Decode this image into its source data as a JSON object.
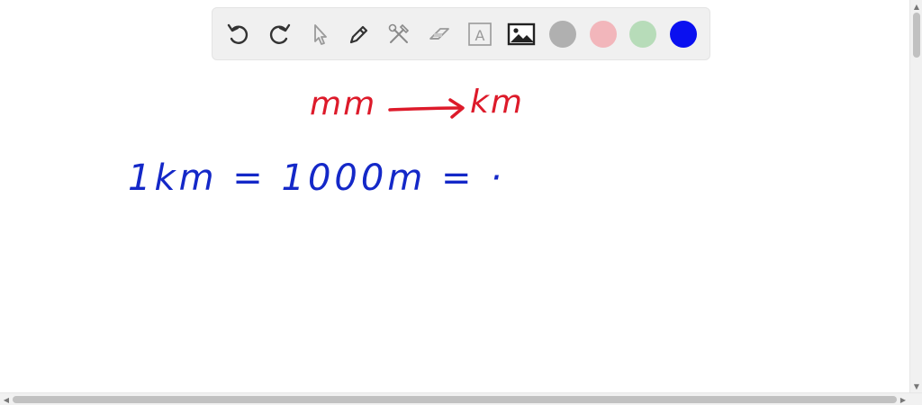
{
  "toolbar": {
    "tools": [
      {
        "name": "undo-icon"
      },
      {
        "name": "redo-icon"
      },
      {
        "name": "select-arrow-icon"
      },
      {
        "name": "pen-icon"
      },
      {
        "name": "tools-icon"
      },
      {
        "name": "eraser-icon"
      },
      {
        "name": "text-box-icon",
        "glyph": "A"
      },
      {
        "name": "image-icon"
      }
    ],
    "colors": [
      {
        "name": "gray",
        "hex": "#b0b0b0"
      },
      {
        "name": "pink",
        "hex": "#f2b6bb"
      },
      {
        "name": "light-green",
        "hex": "#b7dcb9"
      },
      {
        "name": "blue",
        "hex": "#0a10f0",
        "selected": true
      }
    ]
  },
  "canvas": {
    "line1": {
      "text": "mm",
      "color": "#dd1a2a"
    },
    "line1_target": {
      "text": "km",
      "color": "#dd1a2a"
    },
    "line2": {
      "text": "1km = 1000m = ·",
      "color": "#1428c8"
    }
  },
  "scrollbars": {
    "left_arrow": "◀",
    "right_arrow": "▶",
    "up_arrow": "▲",
    "down_arrow": "▼"
  }
}
